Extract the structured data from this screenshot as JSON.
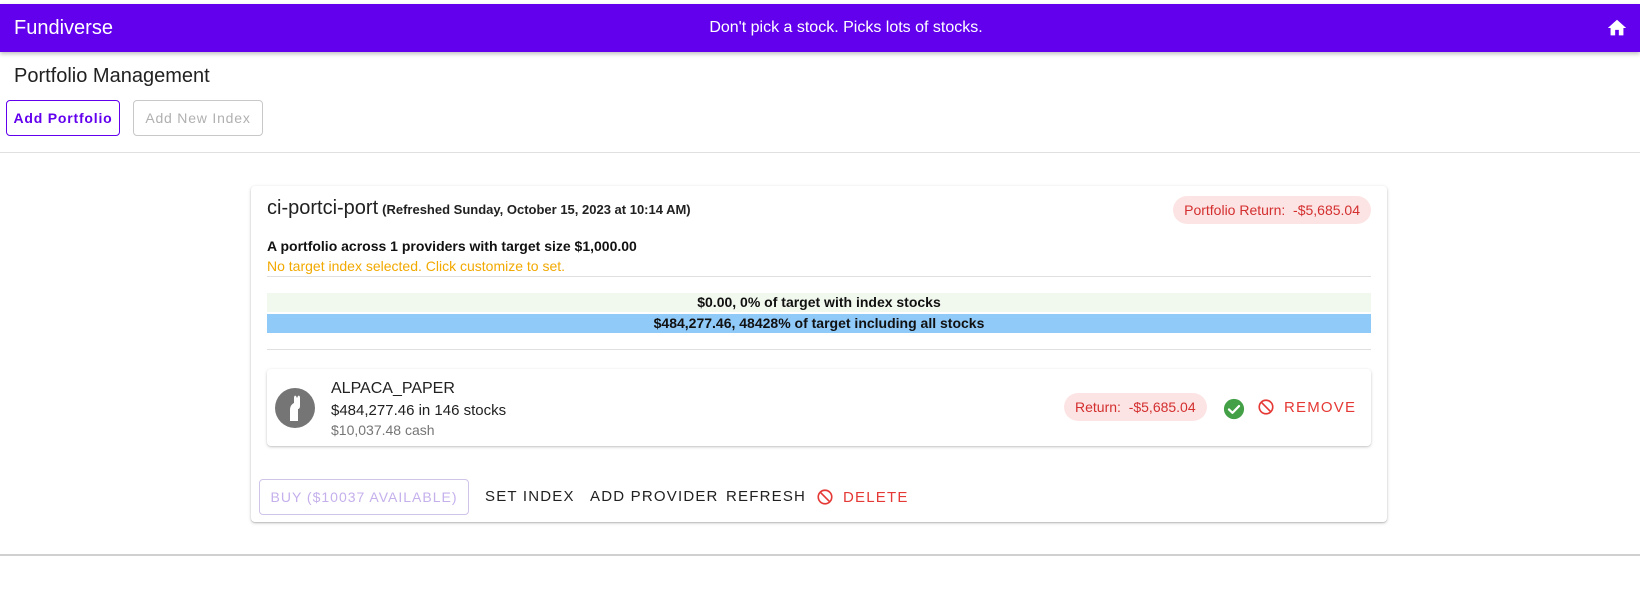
{
  "topbar": {
    "brand": "Fundiverse",
    "tagline": "Don't pick a stock. Picks lots of stocks.",
    "home_icon": "home-icon"
  },
  "page": {
    "title": "Portfolio Management",
    "add_portfolio_label": "Add Portfolio",
    "add_index_label": "Add New Index"
  },
  "portfolio": {
    "name": "ci-portci-port",
    "refreshed": "(Refreshed Sunday, October 15, 2023 at 10:14 AM)",
    "return_chip": "Portfolio Return:  -$5,685.04",
    "summary": "A portfolio across 1 providers with target size $1,000.00",
    "warning": "No target index selected. Click customize to set.",
    "index_bar": "$0.00, 0% of target with index stocks",
    "all_bar": "$484,277.46, 48428% of target including all stocks",
    "provider": {
      "name": "ALPACA_PAPER",
      "stocks": "$484,277.46 in 146 stocks",
      "cash": "$10,037.48 cash",
      "return_chip": "Return:  -$5,685.04",
      "remove_label": "REMOVE",
      "avatar_icon": "alpaca-icon",
      "status_icon": "check-circle-icon"
    },
    "actions": {
      "buy_label": "BUY ($10037 AVAILABLE)",
      "set_index_label": "SET INDEX",
      "add_provider_label": "ADD PROVIDER",
      "refresh_label": "REFRESH",
      "delete_label": "DELETE"
    }
  },
  "colors": {
    "primary": "#6200ee",
    "danger": "#e53935",
    "warning": "#f2a900",
    "success": "#43a047",
    "bar_all": "#90caf9",
    "bar_index": "#f1f8ee"
  }
}
